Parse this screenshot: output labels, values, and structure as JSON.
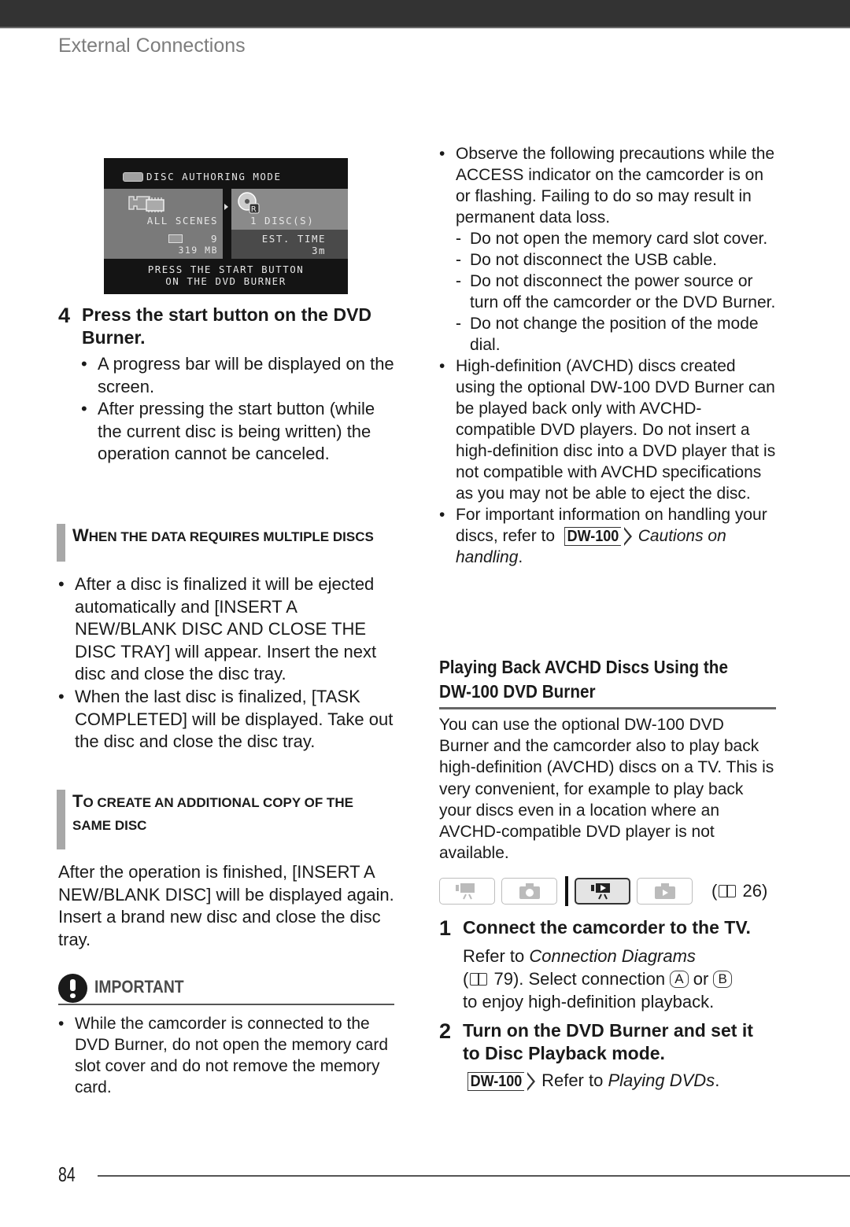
{
  "header": {
    "section_title": "External Connections"
  },
  "lcd_screen": {
    "title": "DISC AUTHORING MODE",
    "source_label": "ALL SCENES",
    "scene_count": "9",
    "data_size": "319 MB",
    "disc_count_label": "1 DISC(S)",
    "est_time_label": "EST. TIME",
    "est_time_value": "3m",
    "instruction_line1": "PRESS THE START BUTTON",
    "instruction_line2": "ON THE DVD BURNER"
  },
  "left_column": {
    "step4": {
      "number": "4",
      "title_line1": "Press the start button on the DVD",
      "title_line2": "Burner.",
      "bullets": [
        "A progress bar will be displayed on the screen.",
        "After pressing the start button (while the current disc is being written) the operation cannot be canceled."
      ]
    },
    "multiple_discs": {
      "heading_cap": "W",
      "heading_rest": "HEN THE DATA REQUIRES MULTIPLE DISCS",
      "bullets": [
        "After a disc is finalized it will be ejected automatically and [INSERT A NEW/BLANK DISC AND CLOSE THE DISC TRAY] will appear. Insert the next disc and close the disc tray.",
        "When the last disc is finalized, [TASK COMPLETED] will be displayed. Take out the disc and close the disc tray."
      ]
    },
    "additional_copy": {
      "heading_cap": "T",
      "heading_rest_line1": "O CREATE AN ADDITIONAL COPY OF THE",
      "heading_line2": "SAME DISC",
      "body": "After the operation is finished, [INSERT A NEW/BLANK DISC] will be displayed again. Insert a brand new disc and close the disc tray."
    },
    "important": {
      "label": "IMPORTANT",
      "bullets": [
        "While the camcorder is connected to the DVD Burner, do not open the memory card slot cover and do not remove the memory card."
      ]
    }
  },
  "right_column": {
    "precautions": {
      "intro": "Observe the following precautions while the ACCESS indicator on the camcorder is on or flashing. Failing to do so may result in permanent data loss.",
      "items": [
        "Do not open the memory card slot cover.",
        "Do not disconnect the USB cable.",
        "Do not disconnect the power source or turn off the camcorder or the DVD Burner.",
        "Do not change the position of the mode dial."
      ]
    },
    "avchd_note": "High-definition (AVCHD) discs created using the optional DW-100 DVD Burner can be played back only with AVCHD-compatible DVD players. Do not insert a high-definition disc into a DVD player that is not compatible with AVCHD specifications as you may not be able to eject the disc.",
    "handling_note": {
      "prefix": "For important information on handling your discs, refer to",
      "badge": "DW-100",
      "italic": "Cautions on handling",
      "suffix": "."
    },
    "playback_section": {
      "heading_line1": "Playing Back AVCHD Discs Using the",
      "heading_line2": "DW-100 DVD Burner",
      "intro": "You can use the optional DW-100 DVD Burner and the camcorder also to play back high-definition (AVCHD) discs on a TV. This is very convenient, for example to play back your discs even in a location where an AVCHD-compatible DVD player is not available.",
      "modes": [
        {
          "name": "movie-record-mode",
          "icon": "video-camera-icon",
          "active": false
        },
        {
          "name": "photo-record-mode",
          "icon": "camera-icon",
          "active": false
        },
        {
          "name": "movie-playback-mode",
          "icon": "video-play-icon",
          "active": true
        },
        {
          "name": "photo-playback-mode",
          "icon": "photo-play-icon",
          "active": false
        }
      ],
      "mode_page_ref": "26",
      "step1": {
        "number": "1",
        "title": "Connect the camcorder to the TV.",
        "refer_prefix": "Refer to",
        "refer_italic": "Connection Diagrams",
        "page_ref": "79",
        "select_text": "). Select connection",
        "conn_a": "A",
        "or_text": "or",
        "conn_b": "B",
        "tail": "to enjoy high-definition playback."
      },
      "step2": {
        "number": "2",
        "title_line1": "Turn on the DVD Burner and set it",
        "title_line2": "to Disc Playback mode.",
        "badge": "DW-100",
        "refer_prefix": "Refer to",
        "refer_italic": "Playing DVDs",
        "suffix": "."
      }
    }
  },
  "footer": {
    "page_number": "84"
  }
}
